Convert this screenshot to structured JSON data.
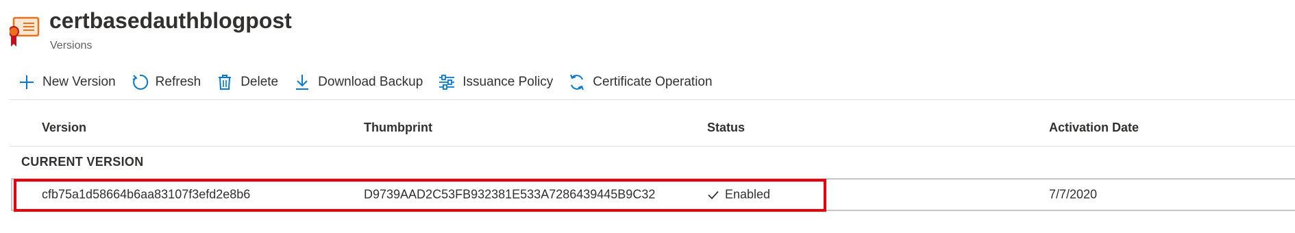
{
  "header": {
    "title": "certbasedauthblogpost",
    "subtitle": "Versions",
    "icon": "certificate-icon"
  },
  "toolbar": {
    "buttons": [
      {
        "label": "New Version",
        "icon": "plus-icon"
      },
      {
        "label": "Refresh",
        "icon": "refresh-icon"
      },
      {
        "label": "Delete",
        "icon": "trash-icon"
      },
      {
        "label": "Download Backup",
        "icon": "download-icon"
      },
      {
        "label": "Issuance Policy",
        "icon": "sliders-icon"
      },
      {
        "label": "Certificate Operation",
        "icon": "sync-icon"
      }
    ]
  },
  "table": {
    "columns": [
      "Version",
      "Thumbprint",
      "Status",
      "Activation Date"
    ],
    "groups": [
      {
        "label": "CURRENT VERSION",
        "rows": [
          {
            "version": "cfb75a1d58664b6aa83107f3efd2e8b6",
            "thumbprint": "D9739AAD2C53FB932381E533A7286439445B9C32",
            "status": "Enabled",
            "activation_date": "7/7/2020"
          }
        ]
      }
    ]
  },
  "colors": {
    "accent": "#0078d4",
    "highlight": "#e8000b",
    "cert_orange": "#e8711a"
  }
}
